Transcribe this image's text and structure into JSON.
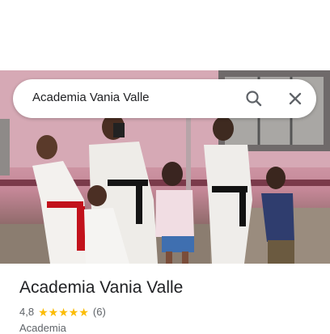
{
  "search": {
    "query": "Academia Vania Valle"
  },
  "place": {
    "name": "Academia Vania Valle",
    "rating": "4,8",
    "stars": 5,
    "review_count": "(6)",
    "category": "Academia"
  },
  "icons": {
    "search": "search-icon",
    "close": "close-icon",
    "star": "star-icon"
  },
  "colors": {
    "star": "#fbbc04",
    "text_primary": "#202124",
    "text_secondary": "#5f6368"
  }
}
